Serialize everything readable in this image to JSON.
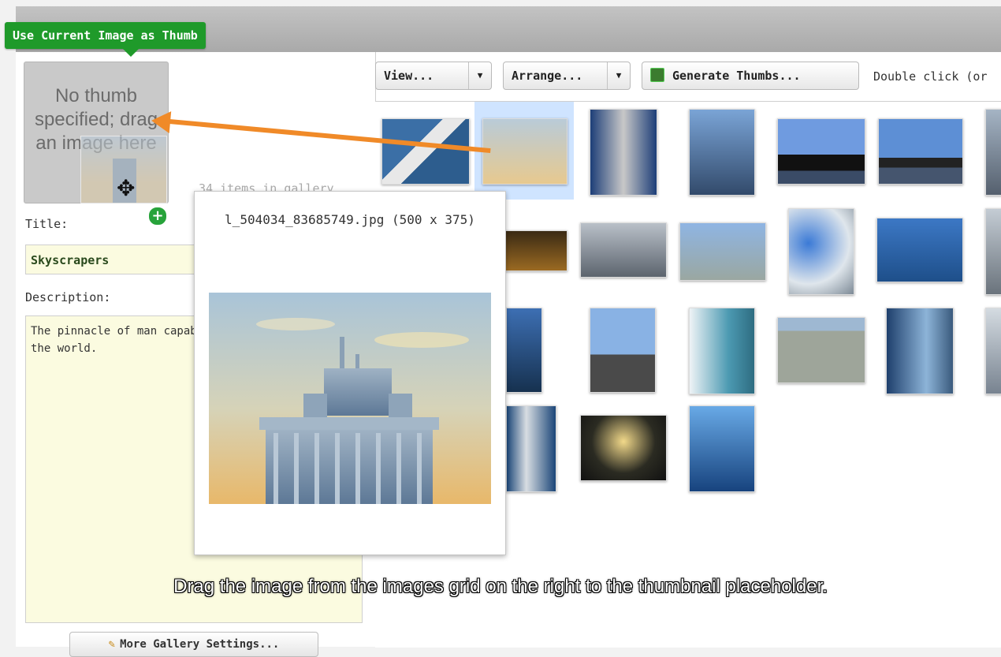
{
  "tooltip": {
    "use_current_image": "Use Current Image as Thumb"
  },
  "thumb_placeholder": {
    "text": "No thumb specified; drag an image here"
  },
  "gallery": {
    "items_count_text": "34 items in gallery"
  },
  "form": {
    "title_label": "Title:",
    "title_value": "Skyscrapers",
    "description_label": "Description:",
    "description_value": "The pinnacle of man capabilities.  A collec around the world."
  },
  "buttons": {
    "more_settings": "More Gallery Settings...",
    "view": "View...",
    "arrange": "Arrange...",
    "generate": "Generate Thumbs..."
  },
  "toolbar": {
    "hint": "Double click (or"
  },
  "preview": {
    "filename": "l_504034_83685749.jpg (500 x 375)"
  },
  "caption": "Drag the image from the images grid on the right to the thumbnail placeholder.",
  "colors": {
    "accent_green": "#1f9a2a",
    "drag_arrow": "#f08a28",
    "selection": "#cfe4ff",
    "field_bg": "#fbfbe0"
  }
}
